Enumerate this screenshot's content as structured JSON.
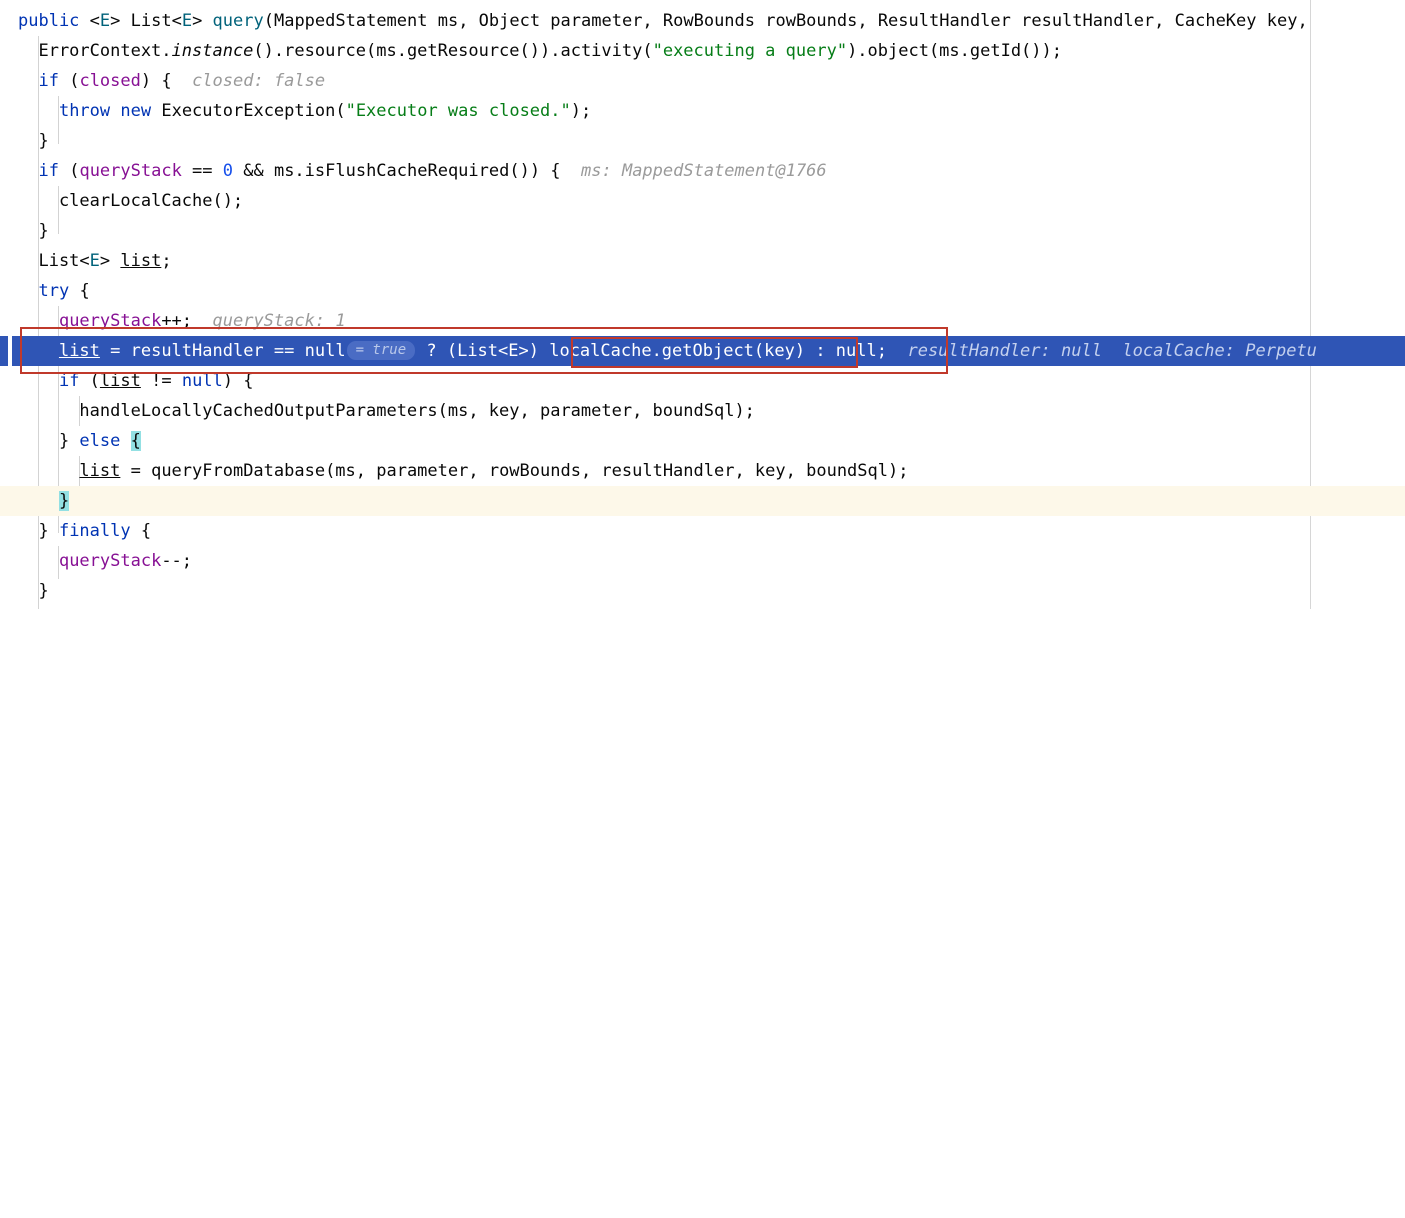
{
  "window": {
    "title": "Java Debugger — BaseExecutor.query",
    "language": "java"
  },
  "editor": {
    "font_size_px": 17,
    "line_height_px": 30,
    "right_margin_guide_x": 1310,
    "colors": {
      "background": "#ffffff",
      "foreground": "#080808",
      "keyword": "#0033b3",
      "string": "#067d17",
      "number": "#1750eb",
      "field": "#871094",
      "method": "#00627a",
      "inline_hint": "#9a9a9a",
      "exec_line_background": "#2f55b5",
      "exec_line_foreground": "#ffffff",
      "exec_line_hint": "#c3d0ee",
      "caret_line_background": "#fdf8e9",
      "brace_match_highlight": "#93e0e3",
      "annotation_red": "#c0392b",
      "indent_guide": "#d3d3d3",
      "pill_background": "#4a6cc4",
      "pill_foreground": "#b9c8ea"
    }
  },
  "code": {
    "clipped_top_fragment": "{",
    "lines": [
      {
        "id": "line-signature",
        "text": "public <E> List<E> query(MappedStatement ms, Object parameter, RowBounds rowBounds, ResultHandler resultHandler, CacheKey key,",
        "indent": 0
      },
      {
        "id": "line-errorcontext",
        "text": "ErrorContext.instance().resource(ms.getResource()).activity(\"executing a query\").object(ms.getId());",
        "indent": 1
      },
      {
        "id": "line-if-closed",
        "text": "if (closed) {",
        "indent": 1,
        "hint": "closed: false"
      },
      {
        "id": "line-throw",
        "text": "throw new ExecutorException(\"Executor was closed.\");",
        "indent": 2
      },
      {
        "id": "line-close-brace-1",
        "text": "}",
        "indent": 1
      },
      {
        "id": "line-if-querystack",
        "text": "if (queryStack == 0 && ms.isFlushCacheRequired()) {",
        "indent": 1,
        "hint": "ms: MappedStatement@1766"
      },
      {
        "id": "line-clearlocalcache",
        "text": "clearLocalCache();",
        "indent": 2
      },
      {
        "id": "line-close-brace-2",
        "text": "}",
        "indent": 1
      },
      {
        "id": "line-declare-list",
        "text": "List<E> list;",
        "indent": 1
      },
      {
        "id": "line-try",
        "text": "try {",
        "indent": 1
      },
      {
        "id": "line-querystack-inc",
        "text": "queryStack++;",
        "indent": 2,
        "hint": "queryStack: 1"
      },
      {
        "id": "line-exec-ternary",
        "text": "list = resultHandler == null ? (List<E>) localCache.getObject(key) : null;",
        "indent": 2,
        "pill": "= true",
        "hint_result_handler": "resultHandler: null",
        "hint_local_cache_label": "localCache:",
        "hint_local_cache_value": "Perpetu",
        "executing": true
      },
      {
        "id": "line-if-list-notnull",
        "text": "if (list != null) {",
        "indent": 2
      },
      {
        "id": "line-handle-cached",
        "text": "handleLocallyCachedOutputParameters(ms, key, parameter, boundSql);",
        "indent": 3
      },
      {
        "id": "line-else",
        "text": "} else {",
        "indent": 2,
        "brace_match": "{"
      },
      {
        "id": "line-queryfromdatabase",
        "text": "list = queryFromDatabase(ms, parameter, rowBounds, resultHandler, key, boundSql);",
        "indent": 3
      },
      {
        "id": "line-close-brace-3",
        "text": "}",
        "indent": 2,
        "brace_match": "}",
        "caret_line": true
      },
      {
        "id": "line-finally",
        "text": "} finally {",
        "indent": 1
      },
      {
        "id": "line-querystack-dec",
        "text": "queryStack--;",
        "indent": 2
      },
      {
        "id": "line-close-brace-4",
        "text": "}",
        "indent": 1
      }
    ]
  },
  "annotations": {
    "outer_box_label": "full-statement-highlight",
    "inner_box_label": "local-cache-getobject-highlight"
  }
}
